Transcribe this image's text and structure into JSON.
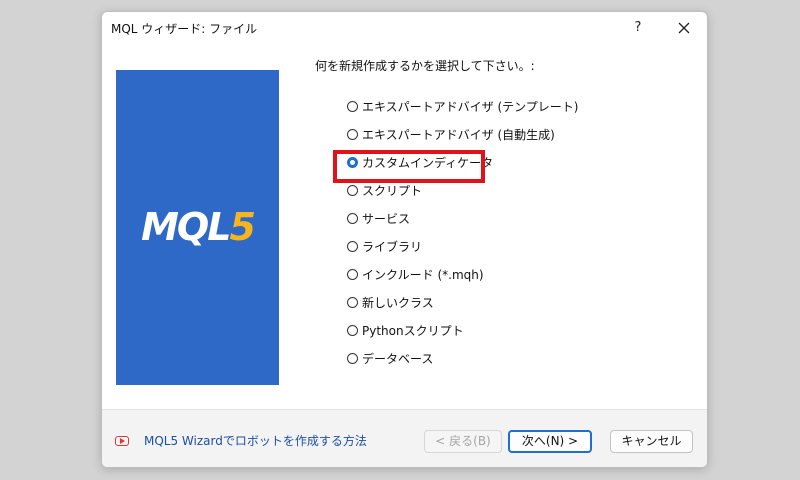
{
  "window": {
    "title": "MQL ウィザード: ファイル",
    "help_label": "?",
    "close_icon": "close-icon"
  },
  "banner": {
    "logo_text_main": "MQL",
    "logo_text_accent": "5",
    "background_color": "#2e69c7",
    "accent_color": "#f5b51f"
  },
  "prompt": "何を新規作成するかを選択して下さい。:",
  "options": [
    {
      "label": "エキスパートアドバイザ (テンプレート)",
      "selected": false
    },
    {
      "label": "エキスパートアドバイザ (自動生成)",
      "selected": false
    },
    {
      "label": "カスタムインディケータ",
      "selected": true
    },
    {
      "label": "スクリプト",
      "selected": false
    },
    {
      "label": "サービス",
      "selected": false
    },
    {
      "label": "ライブラリ",
      "selected": false
    },
    {
      "label": "インクルード (*.mqh)",
      "selected": false
    },
    {
      "label": "新しいクラス",
      "selected": false
    },
    {
      "label": "Pythonスクリプト",
      "selected": false
    },
    {
      "label": "データベース",
      "selected": false
    }
  ],
  "highlight_color": "#e0131b",
  "footer": {
    "help_link": "MQL5 Wizardでロボットを作成する方法",
    "back_button": "< 戻る(B)",
    "next_button": "次へ(N) >",
    "cancel_button": "キャンセル"
  }
}
